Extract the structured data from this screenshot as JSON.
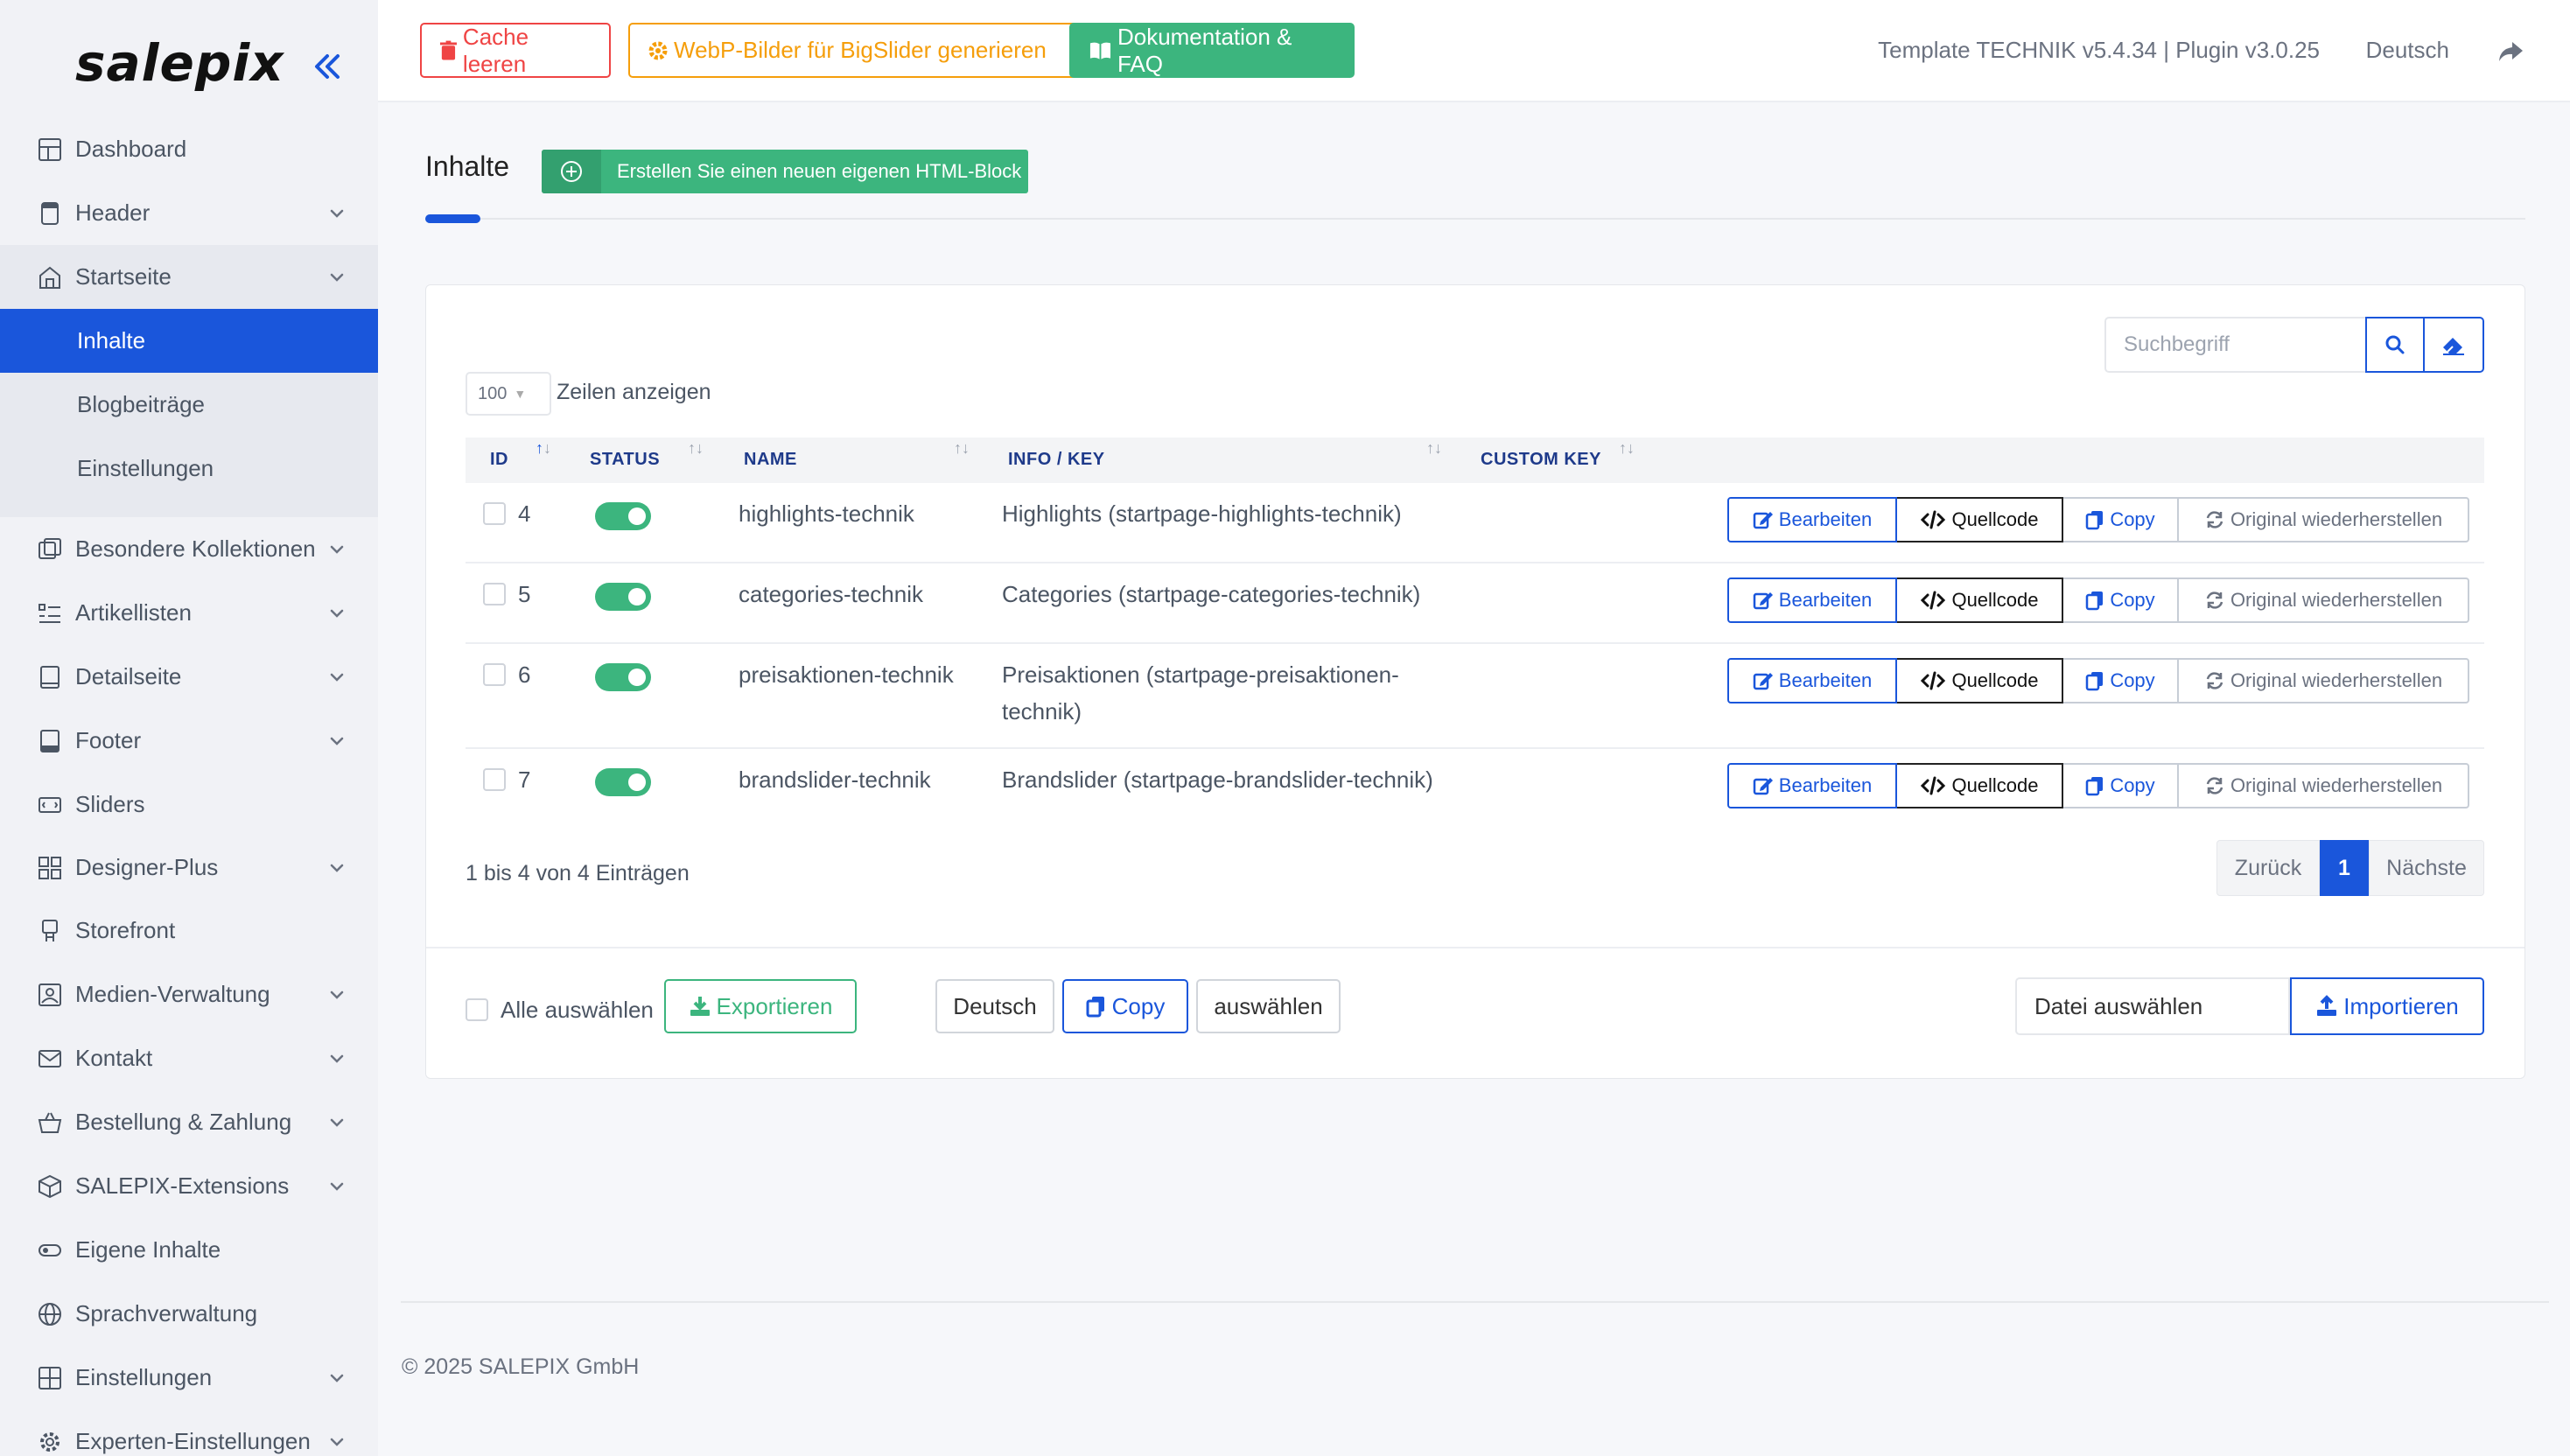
{
  "brand": {
    "logo": "salepix"
  },
  "sidebar": {
    "items": [
      {
        "label": "Dashboard",
        "icon": "dashboard-icon",
        "chevron": false
      },
      {
        "label": "Header",
        "icon": "header-icon",
        "chevron": true
      },
      {
        "label": "Startseite",
        "icon": "home-icon",
        "chevron": true
      },
      {
        "label": "Besondere Kollektionen",
        "icon": "collections-icon",
        "chevron": true
      },
      {
        "label": "Artikellisten",
        "icon": "list-icon",
        "chevron": true
      },
      {
        "label": "Detailseite",
        "icon": "detail-icon",
        "chevron": true
      },
      {
        "label": "Footer",
        "icon": "footer-icon",
        "chevron": true
      },
      {
        "label": "Sliders",
        "icon": "slider-icon",
        "chevron": false
      },
      {
        "label": "Designer-Plus",
        "icon": "designer-icon",
        "chevron": true
      },
      {
        "label": "Storefront",
        "icon": "storefront-icon",
        "chevron": false
      },
      {
        "label": "Medien-Verwaltung",
        "icon": "media-icon",
        "chevron": true
      },
      {
        "label": "Kontakt",
        "icon": "mail-icon",
        "chevron": true
      },
      {
        "label": "Bestellung & Zahlung",
        "icon": "basket-icon",
        "chevron": true
      },
      {
        "label": "SALEPIX-Extensions",
        "icon": "box-icon",
        "chevron": true
      },
      {
        "label": "Eigene Inhalte",
        "icon": "toggle-icon",
        "chevron": false
      },
      {
        "label": "Sprachverwaltung",
        "icon": "globe-icon",
        "chevron": false
      },
      {
        "label": "Einstellungen",
        "icon": "grid-icon",
        "chevron": true
      },
      {
        "label": "Experten-Einstellungen",
        "icon": "gear-icon",
        "chevron": true
      }
    ],
    "subitems": [
      {
        "label": "Inhalte",
        "active": true
      },
      {
        "label": "Blogbeiträge",
        "active": false
      },
      {
        "label": "Einstellungen",
        "active": false
      }
    ]
  },
  "topbar": {
    "cache_label": "Cache leeren",
    "webp_label": "WebP-Bilder für BigSlider generieren",
    "doc_label": "Dokumentation & FAQ",
    "version_info": "Template TECHNIK v5.4.34 | Plugin v3.0.25",
    "language": "Deutsch"
  },
  "page": {
    "title": "Inhalte",
    "new_block_label": "Erstellen Sie einen neuen eigenen HTML-Block"
  },
  "search": {
    "placeholder": "Suchbegriff"
  },
  "table": {
    "rows_per_page": "100",
    "rows_label": "Zeilen anzeigen",
    "columns": [
      "ID",
      "STATUS",
      "NAME",
      "INFO / KEY",
      "CUSTOM KEY"
    ],
    "rows": [
      {
        "id": "4",
        "status": true,
        "name": "highlights-technik",
        "info": "Highlights (startpage-highlights-technik)",
        "custom_key": ""
      },
      {
        "id": "5",
        "status": true,
        "name": "categories-technik",
        "info": "Categories (startpage-categories-technik)",
        "custom_key": ""
      },
      {
        "id": "6",
        "status": true,
        "name": "preisaktionen-technik",
        "info": "Preisaktionen (startpage-preisaktionen-technik)",
        "custom_key": ""
      },
      {
        "id": "7",
        "status": true,
        "name": "brandslider-technik",
        "info": "Brandslider (startpage-brandslider-technik)",
        "custom_key": ""
      }
    ],
    "actions": {
      "edit": "Bearbeiten",
      "source": "Quellcode",
      "copy": "Copy",
      "restore": "Original wiederherstellen"
    },
    "info_text": "1 bis 4 von 4 Einträgen",
    "pager": {
      "prev": "Zurück",
      "current": "1",
      "next": "Nächste"
    }
  },
  "footer_actions": {
    "select_all": "Alle auswählen",
    "export": "Exportieren",
    "language": "Deutsch",
    "copy": "Copy",
    "choose": "auswählen",
    "file": "Datei auswählen",
    "import": "Importieren"
  },
  "copyright": "© 2025 SALEPIX GmbH",
  "colors": {
    "primary": "#1a56db",
    "success": "#3cb57e",
    "danger": "#ef4444",
    "warning": "#f59e0b"
  }
}
